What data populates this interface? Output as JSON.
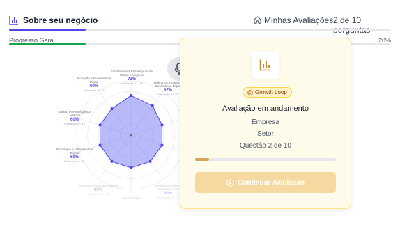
{
  "header": {
    "section_title": "Sobre seu negócio",
    "my_evaluations": "Minhas Avaliações",
    "counter": "2 de 10 perguntas",
    "section_progress": 0.2
  },
  "progress": {
    "label": "Progresso Geral",
    "percent_text": "20%",
    "value": 0.2
  },
  "radar": {
    "values": [
      0.73,
      0.67,
      0.6,
      0.6,
      0.6,
      0.6,
      0.6,
      0.6,
      0.6,
      0.6
    ],
    "labels": [
      {
        "name": "Fundamentos Estratégicos de Marca e Negócio",
        "pct": "73%",
        "sub": "Pontuação: 11 / 15"
      },
      {
        "name": "Liderança, Cultura e Governança Digital",
        "pct": "67%",
        "sub": "Pontuação: 10 / 15"
      },
      {
        "name": "Inovação e Ecossistema Digital",
        "pct": "60%",
        "sub": "Pontuação: 9 / 15"
      },
      {
        "name": "Dados, IA e Inteligência Artificial",
        "pct": "60%",
        "sub": "Pontuação: 9 / 15"
      },
      {
        "name": "Tecnologia e Infraestrutura Digital",
        "pct": "60%",
        "sub": "Pontuação: 9 / 15"
      },
      {
        "name": "Modelos Comerciais Digitais",
        "pct": "60%",
        "sub": "Pontuação: 9 / 15"
      },
      {
        "name": "Marketing Digital e Relacionamento",
        "pct": "60%",
        "sub": "Pontuação: 9 / 15"
      },
      {
        "name": "Gestão Digital",
        "pct": "",
        "sub": ""
      }
    ]
  },
  "card": {
    "badge": "Growth Loop",
    "title": "Avaliação em andamento",
    "company": "Empresa",
    "sector": "Setor",
    "question": "Questão 2 de 10",
    "progress": 0.1,
    "button": "Continuar Avaliação"
  },
  "colors": {
    "accent": "#4f46e5",
    "progress": "#16a34a",
    "gold": "#d4a657",
    "card_bg": "#fffbeb"
  }
}
